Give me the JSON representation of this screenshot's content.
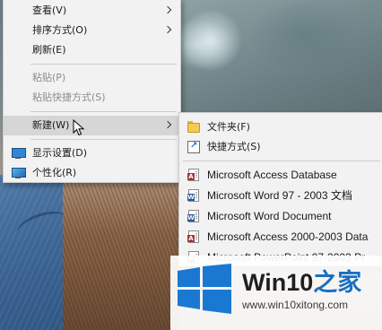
{
  "context_menu": {
    "items": [
      {
        "label": "查看(V)",
        "has_submenu": true,
        "disabled": false
      },
      {
        "label": "排序方式(O)",
        "has_submenu": true,
        "disabled": false
      },
      {
        "label": "刷新(E)",
        "has_submenu": false,
        "disabled": false
      },
      {
        "label": "粘贴(P)",
        "has_submenu": false,
        "disabled": true
      },
      {
        "label": "粘贴快捷方式(S)",
        "has_submenu": false,
        "disabled": true
      },
      {
        "label": "新建(W)",
        "has_submenu": true,
        "disabled": false,
        "highlighted": true
      },
      {
        "label": "显示设置(D)",
        "icon": "display-settings-icon",
        "disabled": false
      },
      {
        "label": "个性化(R)",
        "icon": "personalize-icon",
        "disabled": false
      }
    ]
  },
  "new_submenu": {
    "items": [
      {
        "label": "文件夹(F)",
        "icon": "folder-icon"
      },
      {
        "label": "快捷方式(S)",
        "icon": "shortcut-icon"
      },
      {
        "label": "Microsoft Access Database",
        "icon": "access-file-icon"
      },
      {
        "label": "Microsoft Word 97 - 2003 文档",
        "icon": "word-file-icon"
      },
      {
        "label": "Microsoft Word Document",
        "icon": "word-file-icon"
      },
      {
        "label": "Microsoft Access 2000-2003 Data",
        "icon": "access-file-icon"
      },
      {
        "label": "Microsoft PowerPoint 97-2003 Pr",
        "icon": "powerpoint-file-icon"
      }
    ]
  },
  "watermark": {
    "title_main": "Win10",
    "title_accent": "之家",
    "url": "www.win10xitong.com"
  },
  "colors": {
    "menu_background": "#f2f2f2",
    "highlight": "#d6d6d6",
    "watermark_blue": "#1a6fc1"
  }
}
